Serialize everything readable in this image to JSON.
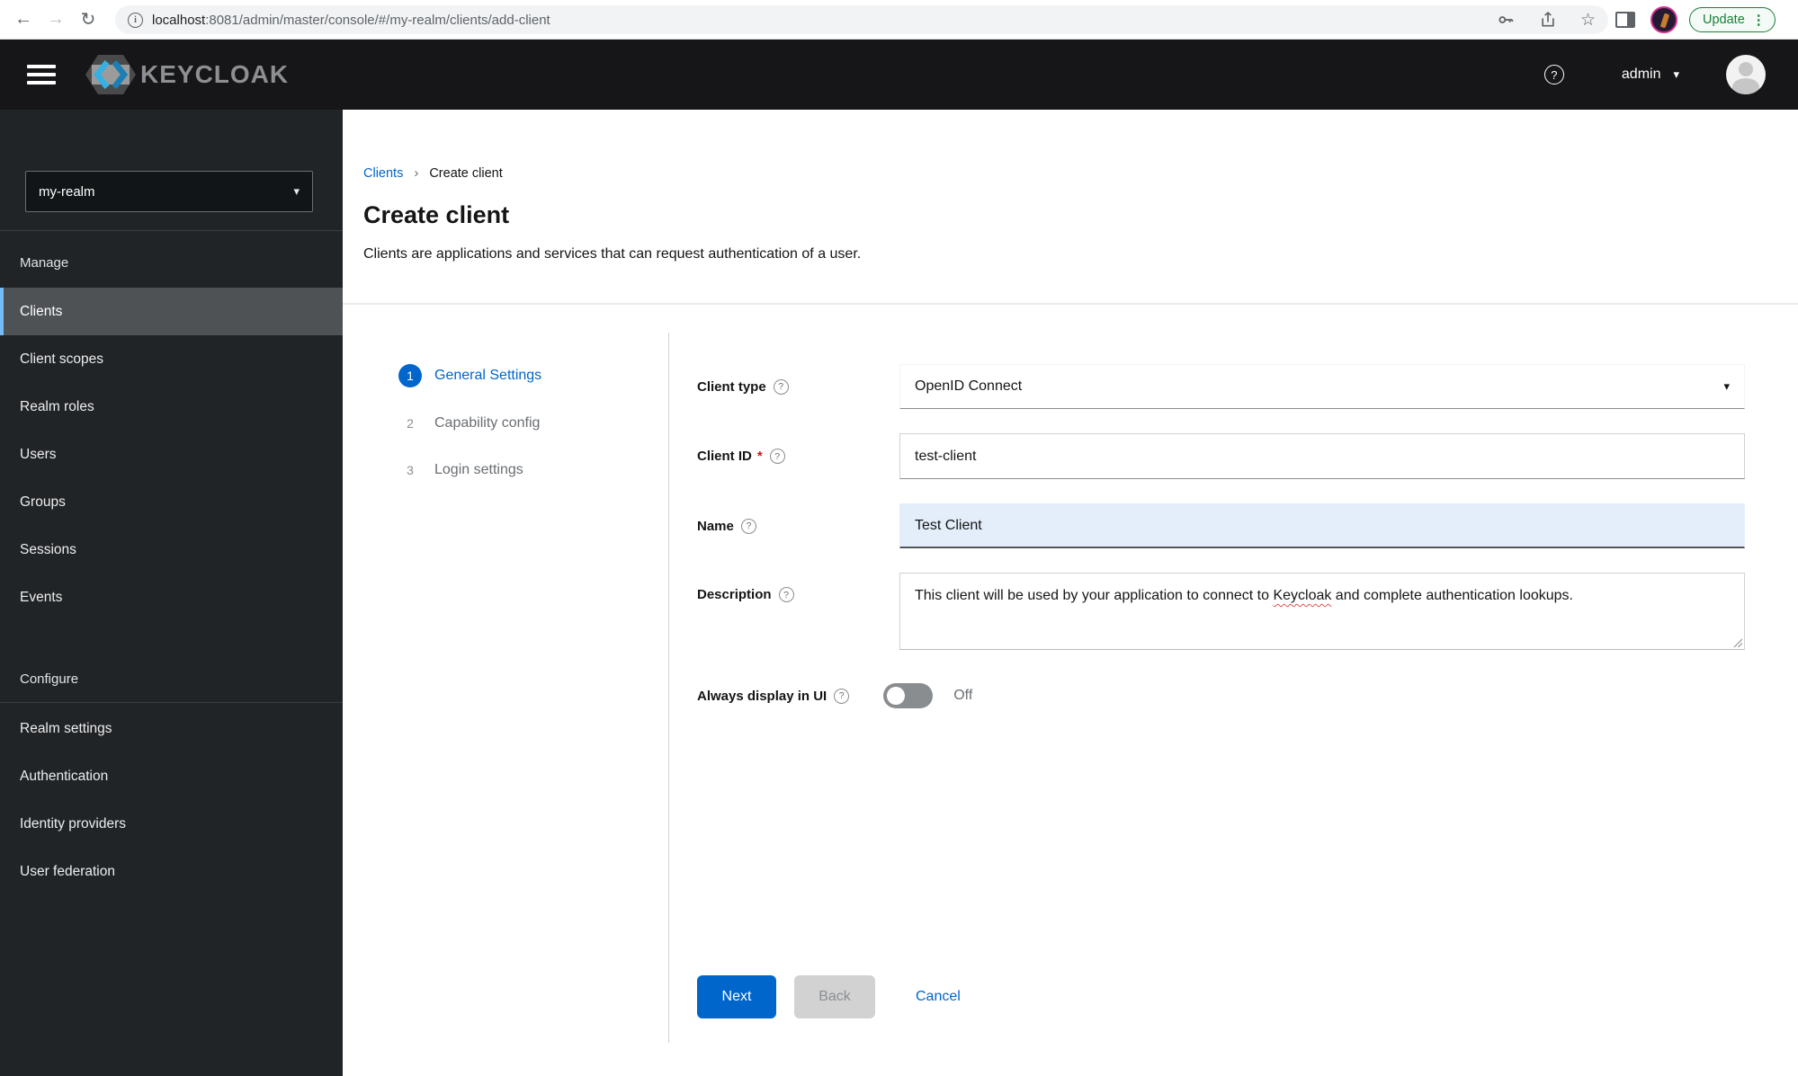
{
  "browser": {
    "url_host": "localhost",
    "url_rest": ":8081/admin/master/console/#/my-realm/clients/add-client",
    "update_label": "Update"
  },
  "header": {
    "brand": "KEYCLOAK",
    "username": "admin"
  },
  "sidebar": {
    "realm": "my-realm",
    "manage_heading": "Manage",
    "manage_items": [
      "Clients",
      "Client scopes",
      "Realm roles",
      "Users",
      "Groups",
      "Sessions",
      "Events"
    ],
    "active_item": "Clients",
    "configure_heading": "Configure",
    "configure_items": [
      "Realm settings",
      "Authentication",
      "Identity providers",
      "User federation"
    ]
  },
  "breadcrumb": {
    "parent": "Clients",
    "current": "Create client"
  },
  "page": {
    "title": "Create client",
    "subtitle": "Clients are applications and services that can request authentication of a user."
  },
  "wizard": {
    "steps": [
      {
        "number": "1",
        "label": "General Settings"
      },
      {
        "number": "2",
        "label": "Capability config"
      },
      {
        "number": "3",
        "label": "Login settings"
      }
    ]
  },
  "form": {
    "client_type": {
      "label": "Client type",
      "value": "OpenID Connect"
    },
    "client_id": {
      "label": "Client ID",
      "required_marker": "*",
      "value": "test-client"
    },
    "name": {
      "label": "Name",
      "value": "Test Client"
    },
    "description": {
      "label": "Description",
      "text_before": "This client will be used by your application to connect to ",
      "text_misspelled": "Keycloak",
      "text_after": " and complete authentication lookups."
    },
    "always_display": {
      "label": "Always display in UI",
      "state": "Off"
    }
  },
  "actions": {
    "next": "Next",
    "back": "Back",
    "cancel": "Cancel"
  },
  "icons": {
    "back": "←",
    "forward": "→",
    "reload": "↻",
    "info": "i",
    "star": "☆",
    "kebab": "⋮",
    "question": "?",
    "caret_down": "▾",
    "breadcrumb_sep": "›"
  },
  "colors": {
    "accent": "#0066cc",
    "nav_active_border": "#73bcf7",
    "required_red": "#c9190b",
    "update_green": "#188038",
    "autofill_blue": "#e4eefb"
  }
}
